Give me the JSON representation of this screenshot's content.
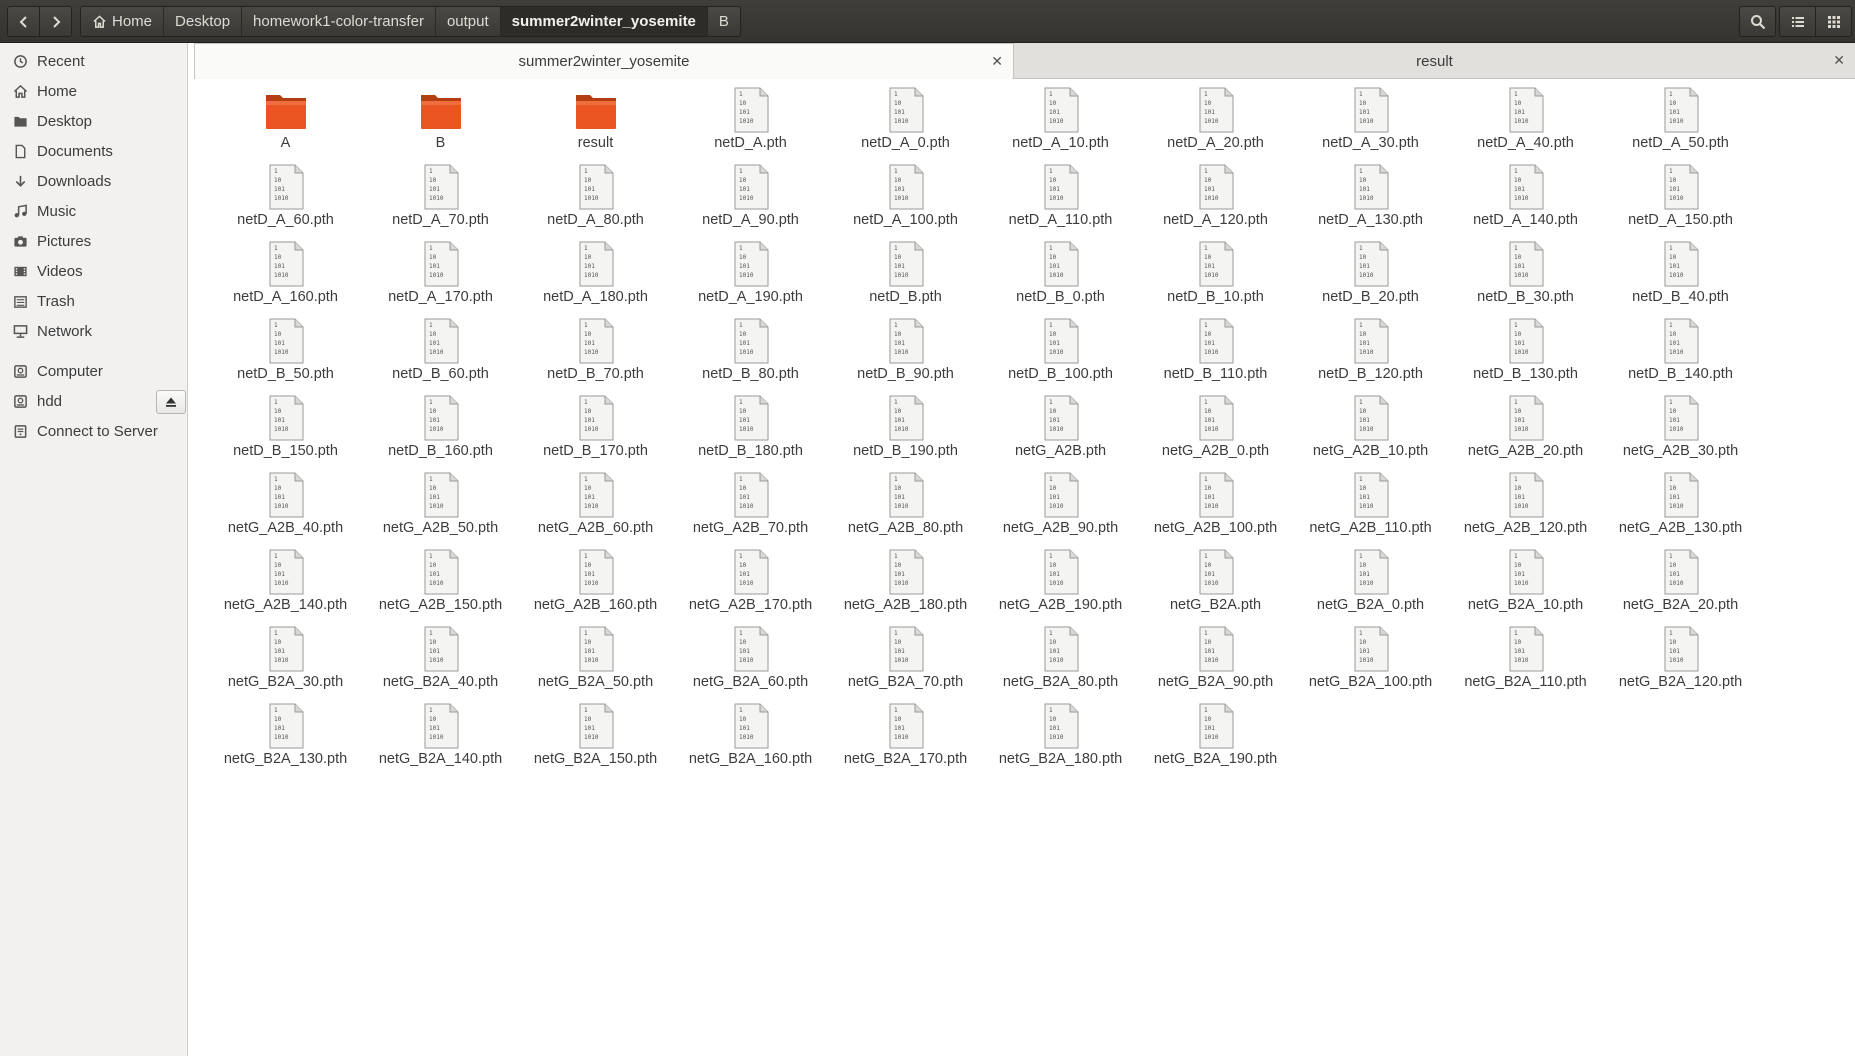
{
  "header": {
    "back_icon": "chevron-left-icon",
    "forward_icon": "chevron-right-icon",
    "breadcrumbs": [
      "Home",
      "Desktop",
      "homework1-color-transfer",
      "output",
      "summer2winter_yosemite",
      "B"
    ],
    "active_crumb_index": 4,
    "search_icon": "search-icon",
    "list_view_icon": "list-view-icon",
    "grid_view_icon": "grid-view-icon"
  },
  "sidebar": {
    "items": [
      {
        "label": "Recent",
        "icon": "clock-icon"
      },
      {
        "label": "Home",
        "icon": "home-icon"
      },
      {
        "label": "Desktop",
        "icon": "folder-icon"
      },
      {
        "label": "Documents",
        "icon": "document-icon"
      },
      {
        "label": "Downloads",
        "icon": "download-icon"
      },
      {
        "label": "Music",
        "icon": "music-icon"
      },
      {
        "label": "Pictures",
        "icon": "camera-icon"
      },
      {
        "label": "Videos",
        "icon": "video-icon"
      },
      {
        "label": "Trash",
        "icon": "trash-icon"
      },
      {
        "label": "Network",
        "icon": "network-icon"
      },
      {
        "label": "Computer",
        "icon": "drive-icon"
      },
      {
        "label": "hdd",
        "icon": "drive-icon"
      },
      {
        "label": "Connect to Server",
        "icon": "server-icon"
      }
    ],
    "eject_icon": "eject-icon"
  },
  "tabs": [
    {
      "label": "summer2winter_yosemite",
      "active": true
    },
    {
      "label": "result",
      "active": false
    }
  ],
  "colors": {
    "folder": "#e95420",
    "header_bg": "#3c3b37",
    "sidebar_bg": "#f2f1f0"
  },
  "files": [
    {
      "name": "A",
      "type": "folder"
    },
    {
      "name": "B",
      "type": "folder"
    },
    {
      "name": "result",
      "type": "folder"
    },
    {
      "name": "netD_A.pth",
      "type": "binary"
    },
    {
      "name": "netD_A_0.pth",
      "type": "binary"
    },
    {
      "name": "netD_A_10.pth",
      "type": "binary"
    },
    {
      "name": "netD_A_20.pth",
      "type": "binary"
    },
    {
      "name": "netD_A_30.pth",
      "type": "binary"
    },
    {
      "name": "netD_A_40.pth",
      "type": "binary"
    },
    {
      "name": "netD_A_50.pth",
      "type": "binary"
    },
    {
      "name": "netD_A_60.pth",
      "type": "binary"
    },
    {
      "name": "netD_A_70.pth",
      "type": "binary"
    },
    {
      "name": "netD_A_80.pth",
      "type": "binary"
    },
    {
      "name": "netD_A_90.pth",
      "type": "binary"
    },
    {
      "name": "netD_A_100.pth",
      "type": "binary"
    },
    {
      "name": "netD_A_110.pth",
      "type": "binary"
    },
    {
      "name": "netD_A_120.pth",
      "type": "binary"
    },
    {
      "name": "netD_A_130.pth",
      "type": "binary"
    },
    {
      "name": "netD_A_140.pth",
      "type": "binary"
    },
    {
      "name": "netD_A_150.pth",
      "type": "binary"
    },
    {
      "name": "netD_A_160.pth",
      "type": "binary"
    },
    {
      "name": "netD_A_170.pth",
      "type": "binary"
    },
    {
      "name": "netD_A_180.pth",
      "type": "binary"
    },
    {
      "name": "netD_A_190.pth",
      "type": "binary"
    },
    {
      "name": "netD_B.pth",
      "type": "binary"
    },
    {
      "name": "netD_B_0.pth",
      "type": "binary"
    },
    {
      "name": "netD_B_10.pth",
      "type": "binary"
    },
    {
      "name": "netD_B_20.pth",
      "type": "binary"
    },
    {
      "name": "netD_B_30.pth",
      "type": "binary"
    },
    {
      "name": "netD_B_40.pth",
      "type": "binary"
    },
    {
      "name": "netD_B_50.pth",
      "type": "binary"
    },
    {
      "name": "netD_B_60.pth",
      "type": "binary"
    },
    {
      "name": "netD_B_70.pth",
      "type": "binary"
    },
    {
      "name": "netD_B_80.pth",
      "type": "binary"
    },
    {
      "name": "netD_B_90.pth",
      "type": "binary"
    },
    {
      "name": "netD_B_100.pth",
      "type": "binary"
    },
    {
      "name": "netD_B_110.pth",
      "type": "binary"
    },
    {
      "name": "netD_B_120.pth",
      "type": "binary"
    },
    {
      "name": "netD_B_130.pth",
      "type": "binary"
    },
    {
      "name": "netD_B_140.pth",
      "type": "binary"
    },
    {
      "name": "netD_B_150.pth",
      "type": "binary"
    },
    {
      "name": "netD_B_160.pth",
      "type": "binary"
    },
    {
      "name": "netD_B_170.pth",
      "type": "binary"
    },
    {
      "name": "netD_B_180.pth",
      "type": "binary"
    },
    {
      "name": "netD_B_190.pth",
      "type": "binary"
    },
    {
      "name": "netG_A2B.pth",
      "type": "binary"
    },
    {
      "name": "netG_A2B_0.pth",
      "type": "binary"
    },
    {
      "name": "netG_A2B_10.pth",
      "type": "binary"
    },
    {
      "name": "netG_A2B_20.pth",
      "type": "binary"
    },
    {
      "name": "netG_A2B_30.pth",
      "type": "binary"
    },
    {
      "name": "netG_A2B_40.pth",
      "type": "binary"
    },
    {
      "name": "netG_A2B_50.pth",
      "type": "binary"
    },
    {
      "name": "netG_A2B_60.pth",
      "type": "binary"
    },
    {
      "name": "netG_A2B_70.pth",
      "type": "binary"
    },
    {
      "name": "netG_A2B_80.pth",
      "type": "binary"
    },
    {
      "name": "netG_A2B_90.pth",
      "type": "binary"
    },
    {
      "name": "netG_A2B_100.pth",
      "type": "binary"
    },
    {
      "name": "netG_A2B_110.pth",
      "type": "binary"
    },
    {
      "name": "netG_A2B_120.pth",
      "type": "binary"
    },
    {
      "name": "netG_A2B_130.pth",
      "type": "binary"
    },
    {
      "name": "netG_A2B_140.pth",
      "type": "binary"
    },
    {
      "name": "netG_A2B_150.pth",
      "type": "binary"
    },
    {
      "name": "netG_A2B_160.pth",
      "type": "binary"
    },
    {
      "name": "netG_A2B_170.pth",
      "type": "binary"
    },
    {
      "name": "netG_A2B_180.pth",
      "type": "binary"
    },
    {
      "name": "netG_A2B_190.pth",
      "type": "binary"
    },
    {
      "name": "netG_B2A.pth",
      "type": "binary"
    },
    {
      "name": "netG_B2A_0.pth",
      "type": "binary"
    },
    {
      "name": "netG_B2A_10.pth",
      "type": "binary"
    },
    {
      "name": "netG_B2A_20.pth",
      "type": "binary"
    },
    {
      "name": "netG_B2A_30.pth",
      "type": "binary"
    },
    {
      "name": "netG_B2A_40.pth",
      "type": "binary"
    },
    {
      "name": "netG_B2A_50.pth",
      "type": "binary"
    },
    {
      "name": "netG_B2A_60.pth",
      "type": "binary"
    },
    {
      "name": "netG_B2A_70.pth",
      "type": "binary"
    },
    {
      "name": "netG_B2A_80.pth",
      "type": "binary"
    },
    {
      "name": "netG_B2A_90.pth",
      "type": "binary"
    },
    {
      "name": "netG_B2A_100.pth",
      "type": "binary"
    },
    {
      "name": "netG_B2A_110.pth",
      "type": "binary"
    },
    {
      "name": "netG_B2A_120.pth",
      "type": "binary"
    },
    {
      "name": "netG_B2A_130.pth",
      "type": "binary"
    },
    {
      "name": "netG_B2A_140.pth",
      "type": "binary"
    },
    {
      "name": "netG_B2A_150.pth",
      "type": "binary"
    },
    {
      "name": "netG_B2A_160.pth",
      "type": "binary"
    },
    {
      "name": "netG_B2A_170.pth",
      "type": "binary"
    },
    {
      "name": "netG_B2A_180.pth",
      "type": "binary"
    },
    {
      "name": "netG_B2A_190.pth",
      "type": "binary"
    }
  ]
}
